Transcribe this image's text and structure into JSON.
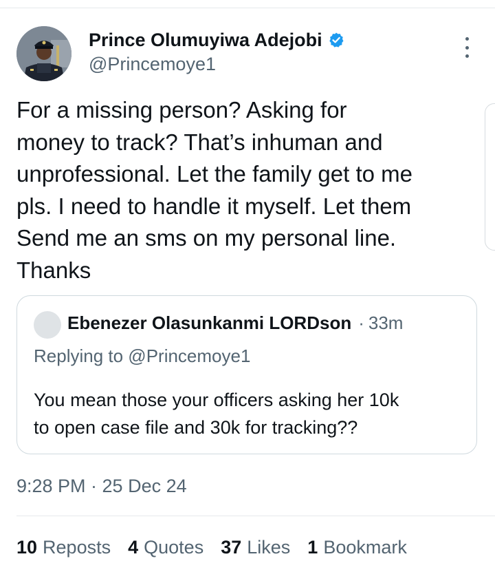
{
  "tweet": {
    "author": {
      "name": "Prince Olumuyiwa Adejobi",
      "handle": "@Princemoye1",
      "verified": true
    },
    "text": "For a missing person?  Asking for\nmoney to track? That’s inhuman and\nunprofessional.  Let the family get to me\npls.  I need to handle it myself. Let them\nSend me an sms on my personal line.\nThanks",
    "quoted": {
      "author": "Ebenezer Olasunkanmi LORDson",
      "separator": "·",
      "time": "33m",
      "replying_to": "Replying to @Princemoye1",
      "text": "You mean those your officers asking her 10k\nto open case file and  30k for tracking??"
    },
    "timestamp": "9:28 PM · 25 Dec 24",
    "stats": {
      "reposts": {
        "count": "10",
        "label": "Reposts"
      },
      "quotes": {
        "count": "4",
        "label": "Quotes"
      },
      "likes": {
        "count": "37",
        "label": "Likes"
      },
      "bookmarks": {
        "count": "1",
        "label": "Bookmark"
      }
    }
  },
  "icons": {
    "verified": "verified-badge-icon",
    "more": "more-vertical-icon"
  },
  "colors": {
    "text_primary": "#0f1419",
    "text_secondary": "#536471",
    "verified_blue": "#1d9bf0",
    "border": "#cfd9de"
  }
}
